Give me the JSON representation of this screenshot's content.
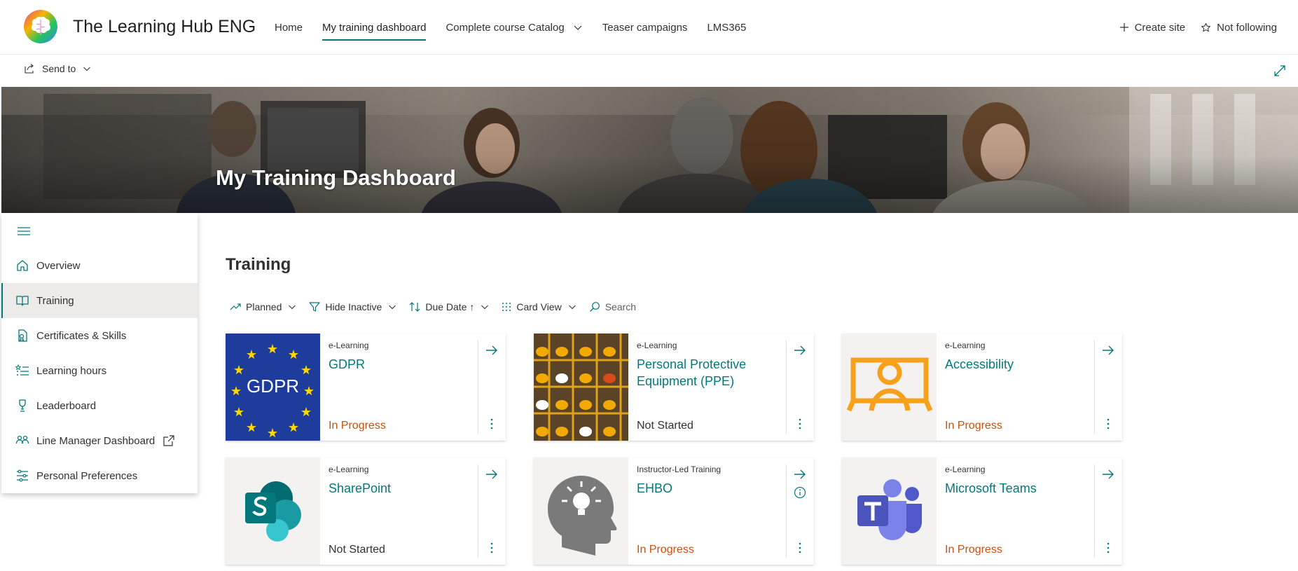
{
  "site": {
    "title": "The Learning Hub ENG",
    "logo_icon": "brain-logo-icon"
  },
  "top_nav": {
    "items": [
      {
        "label": "Home",
        "active": false
      },
      {
        "label": "My training dashboard",
        "active": true
      },
      {
        "label": "Complete course Catalog",
        "active": false,
        "has_dropdown": true
      },
      {
        "label": "Teaser campaigns",
        "active": false
      },
      {
        "label": "LMS365",
        "active": false
      }
    ]
  },
  "header_actions": {
    "create_site": "Create site",
    "not_following": "Not following"
  },
  "command_bar": {
    "send_to": "Send to"
  },
  "hero": {
    "title": "My Training Dashboard"
  },
  "left_nav": {
    "items": [
      {
        "label": "Overview",
        "icon": "home-icon"
      },
      {
        "label": "Training",
        "icon": "book-icon",
        "selected": true
      },
      {
        "label": "Certificates & Skills",
        "icon": "certificate-icon"
      },
      {
        "label": "Learning hours",
        "icon": "list-star-icon"
      },
      {
        "label": "Leaderboard",
        "icon": "trophy-icon"
      },
      {
        "label": "Line Manager Dashboard",
        "icon": "people-icon",
        "external": true
      },
      {
        "label": "Personal Preferences",
        "icon": "sliders-icon"
      }
    ]
  },
  "main": {
    "section_title": "Training",
    "toolbar": {
      "planned": "Planned",
      "hide_inactive": "Hide Inactive",
      "due_date": "Due Date ↑",
      "card_view": "Card View",
      "search": "Search"
    },
    "cards": [
      {
        "type": "e-Learning",
        "title": "GDPR",
        "status": "In Progress",
        "status_key": "in-progress",
        "thumb": "gdpr-flag",
        "thumb_text": "GDPR"
      },
      {
        "type": "e-Learning",
        "title": "Personal Protective Equipment (PPE)",
        "status": "Not Started",
        "status_key": "not-started",
        "thumb": "hardhats"
      },
      {
        "type": "e-Learning",
        "title": "Accessibility",
        "status": "In Progress",
        "status_key": "in-progress",
        "thumb": "accessibility"
      },
      {
        "type": "e-Learning",
        "title": "SharePoint",
        "status": "Not Started",
        "status_key": "not-started",
        "thumb": "sharepoint-logo"
      },
      {
        "type": "Instructor-Led Training",
        "title": "EHBO",
        "status": "In Progress",
        "status_key": "in-progress",
        "thumb": "head-bulb",
        "has_info": true
      },
      {
        "type": "e-Learning",
        "title": "Microsoft Teams",
        "status": "In Progress",
        "status_key": "in-progress",
        "thumb": "teams-logo"
      }
    ]
  },
  "colors": {
    "accent": "#03787c",
    "in_progress": "#ca5010",
    "text": "#323130"
  }
}
